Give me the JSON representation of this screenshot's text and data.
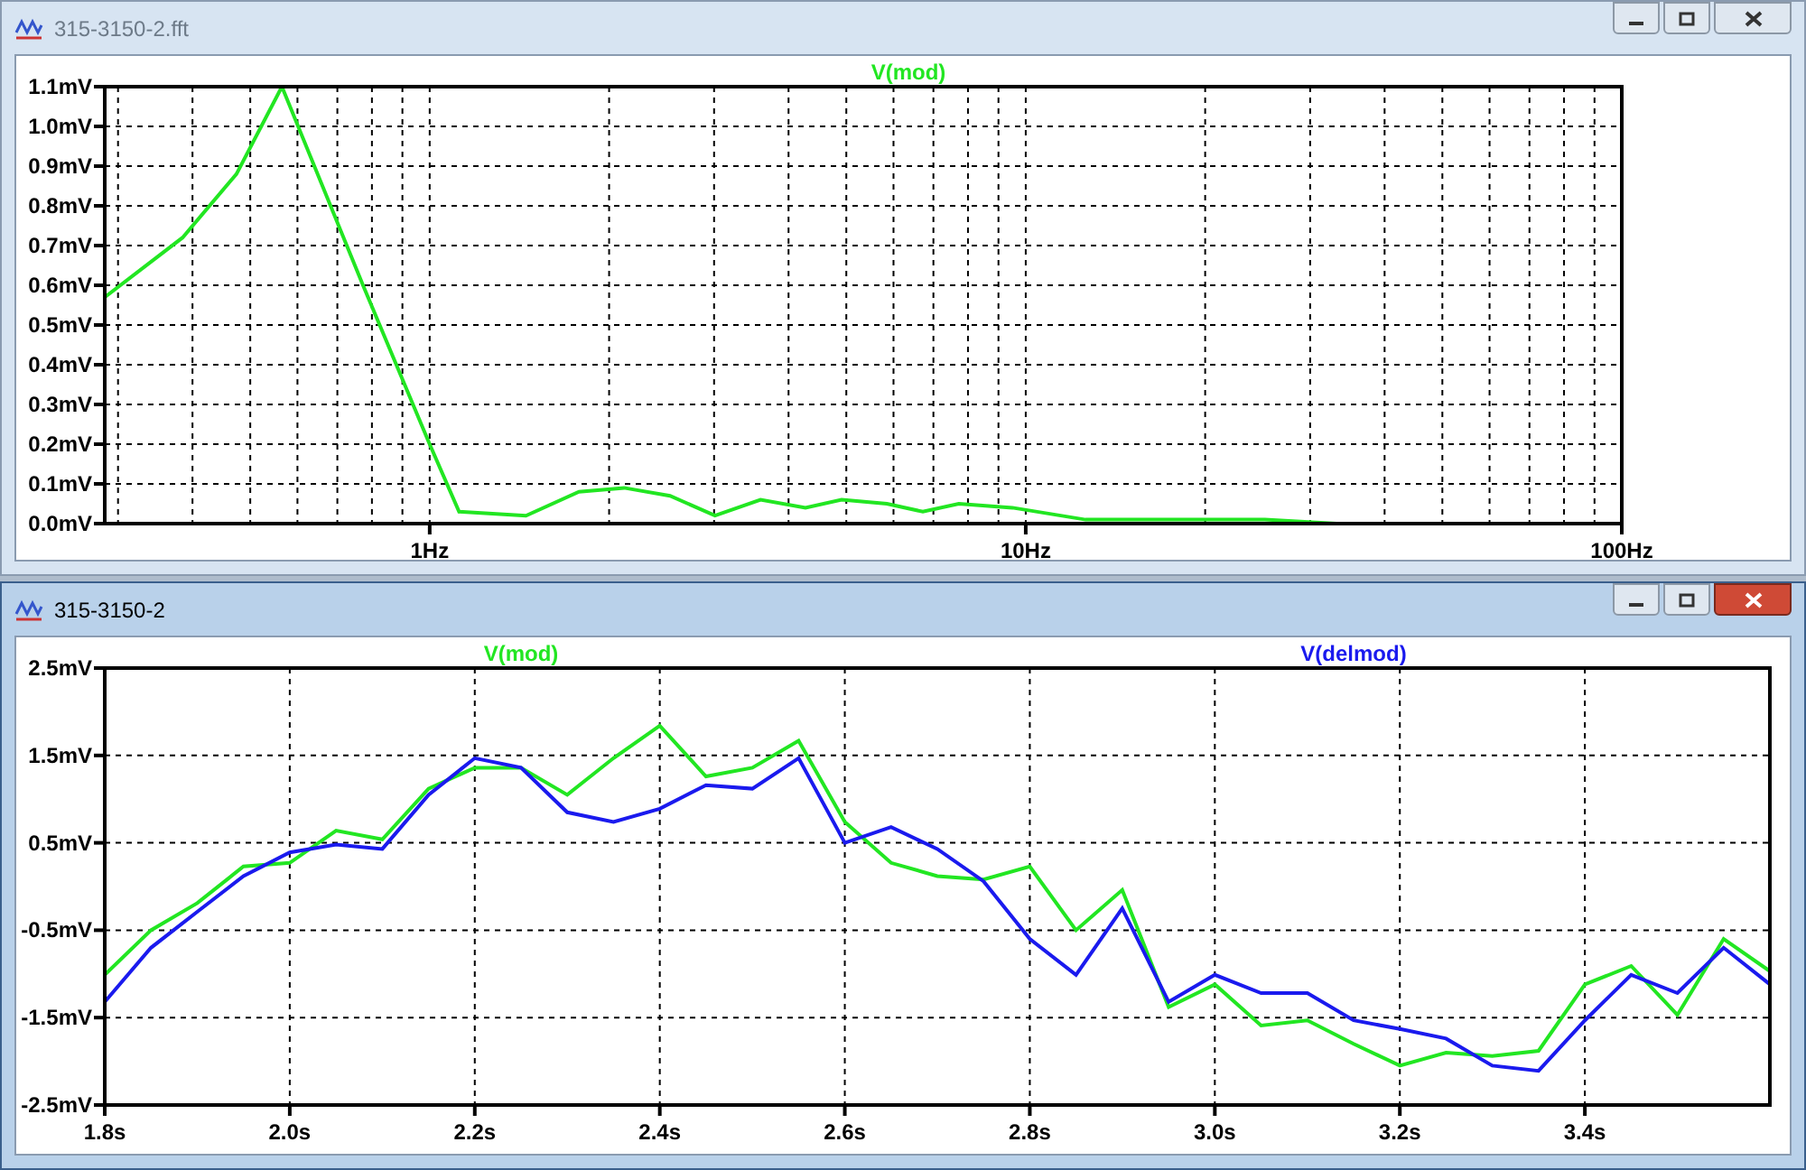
{
  "windows": [
    {
      "title": "315-3150-2.fft",
      "active": false,
      "plot": {
        "kind": "picture",
        "trace_label": "V(mod)",
        "y_axis_labels": [
          "1.1mV",
          "1.0mV",
          "0.9mV",
          "0.8mV",
          "0.7mV",
          "0.6mV",
          "0.5mV",
          "0.4mV",
          "0.3mV",
          "0.2mV",
          "0.1mV",
          "0.0mV"
        ],
        "x_axis_labels": [
          "1Hz",
          "10Hz",
          "100Hz"
        ]
      }
    },
    {
      "title": "315-3150-2",
      "active": true,
      "chart_data": {
        "type": "line",
        "grid": true,
        "x": [
          1.8,
          1.85,
          1.9,
          1.95,
          2.0,
          2.05,
          2.1,
          2.15,
          2.2,
          2.25,
          2.3,
          2.35,
          2.4,
          2.45,
          2.5,
          2.55,
          2.6,
          2.65,
          2.7,
          2.75,
          2.8,
          2.85,
          2.9,
          2.95,
          3.0,
          3.05,
          3.1,
          3.15,
          3.2,
          3.25,
          3.3,
          3.35,
          3.4,
          3.45,
          3.5,
          3.55,
          3.6
        ],
        "series": [
          {
            "name": "V(mod)",
            "color": "#22e622",
            "values": [
              -1.01,
              -0.5,
              -0.19,
              0.23,
              0.27,
              0.64,
              0.54,
              1.12,
              1.36,
              1.36,
              1.05,
              1.47,
              1.84,
              1.26,
              1.36,
              1.67,
              0.74,
              0.27,
              0.12,
              0.08,
              0.23,
              -0.5,
              -0.04,
              -1.38,
              -1.12,
              -1.59,
              -1.53,
              -1.8,
              -2.05,
              -1.9,
              -1.94,
              -1.88,
              -1.12,
              -0.91,
              -1.47,
              -0.6,
              -0.97
            ]
          },
          {
            "name": "V(delmod)",
            "color": "#1a1aee",
            "values": [
              -1.32,
              -0.7,
              -0.29,
              0.12,
              0.39,
              0.48,
              0.43,
              1.05,
              1.47,
              1.36,
              0.85,
              0.74,
              0.89,
              1.16,
              1.12,
              1.47,
              0.5,
              0.68,
              0.43,
              0.06,
              -0.6,
              -1.01,
              -0.25,
              -1.32,
              -1.01,
              -1.22,
              -1.22,
              -1.53,
              -1.63,
              -1.74,
              -2.05,
              -2.11,
              -1.53,
              -1.01,
              -1.22,
              -0.7,
              -1.12
            ]
          }
        ],
        "xlim": [
          1.8,
          3.6
        ],
        "ylim": [
          -2.5,
          2.5
        ],
        "xticks": [
          {
            "value": 1.8,
            "label": "1.8s"
          },
          {
            "value": 2.0,
            "label": "2.0s"
          },
          {
            "value": 2.2,
            "label": "2.2s"
          },
          {
            "value": 2.4,
            "label": "2.4s"
          },
          {
            "value": 2.6,
            "label": "2.6s"
          },
          {
            "value": 2.8,
            "label": "2.8s"
          },
          {
            "value": 3.0,
            "label": "3.0s"
          },
          {
            "value": 3.2,
            "label": "3.2s"
          },
          {
            "value": 3.4,
            "label": "3.4s"
          }
        ],
        "yticks": [
          {
            "value": -2.5,
            "label": "-2.5mV"
          },
          {
            "value": -1.5,
            "label": "-1.5mV"
          },
          {
            "value": -0.5,
            "label": "-0.5mV"
          },
          {
            "value": 0.5,
            "label": "0.5mV"
          },
          {
            "value": 1.5,
            "label": "1.5mV"
          },
          {
            "value": 2.5,
            "label": "2.5mV"
          }
        ]
      }
    }
  ]
}
